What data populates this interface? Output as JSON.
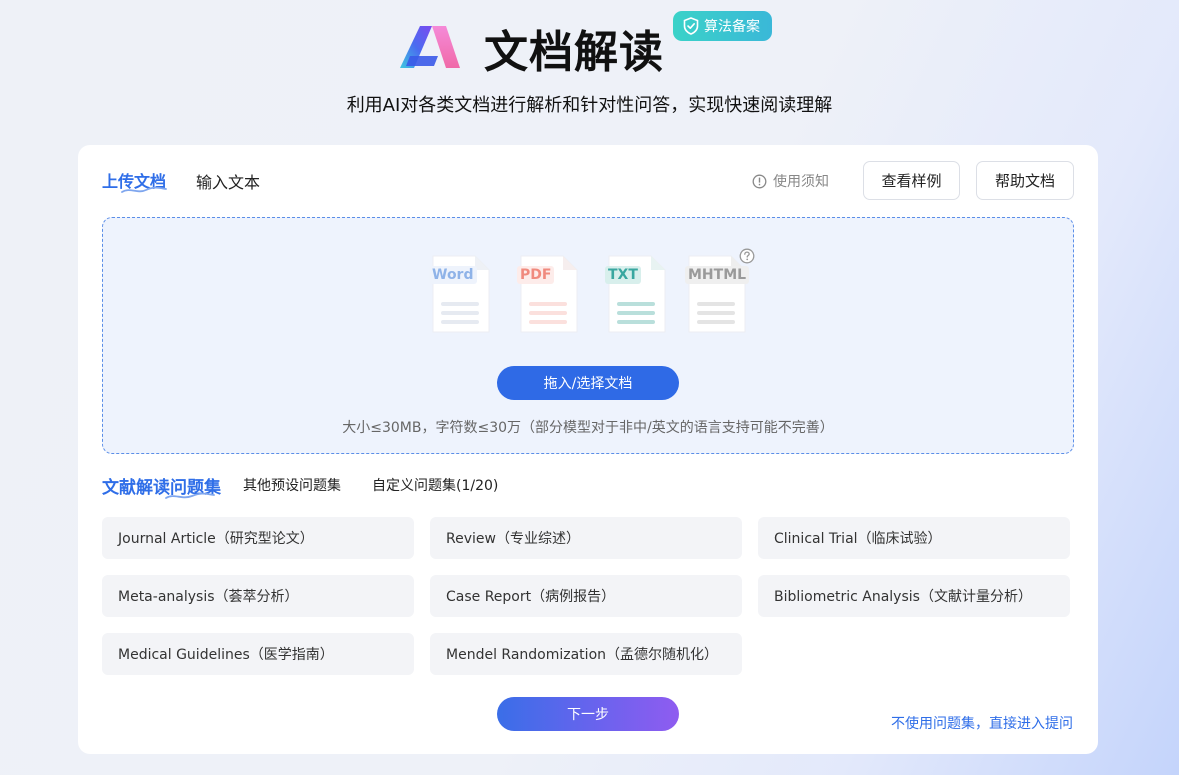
{
  "header": {
    "title": "文档解读",
    "badge": "算法备案",
    "subtitle": "利用AI对各类文档进行解析和针对性问答，实现快速阅读理解"
  },
  "upload": {
    "tabs": [
      "上传文档",
      "输入文本"
    ],
    "notice": "使用须知",
    "example_button": "查看样例",
    "help_button": "帮助文档",
    "file_types": [
      "Word",
      "PDF",
      "TXT",
      "MHTML"
    ],
    "select_button": "拖入/选择文档",
    "hint": "大小≤30MB，字符数≤30万（部分模型对于非中/英文的语言支持可能不完善）"
  },
  "question_sets": {
    "tabs": [
      "文献解读问题集",
      "其他预设问题集",
      "自定义问题集(1/20)"
    ],
    "items": [
      "Journal Article（研究型论文）",
      "Review（专业综述）",
      "Clinical Trial（临床试验）",
      "Meta-analysis（荟萃分析）",
      "Case Report（病例报告）",
      "Bibliometric Analysis（文献计量分析）",
      "Medical Guidelines（医学指南）",
      "Mendel Randomization（孟德尔随机化）"
    ],
    "next_button": "下一步",
    "skip_link": "不使用问题集，直接进入提问"
  },
  "colors": {
    "accent": "#2f6ee8",
    "badge": "#3ac6cf",
    "word": "#8fb3e8",
    "pdf": "#f08a7e",
    "txt": "#3aa7a0",
    "mhtml": "#9a9a9a"
  }
}
